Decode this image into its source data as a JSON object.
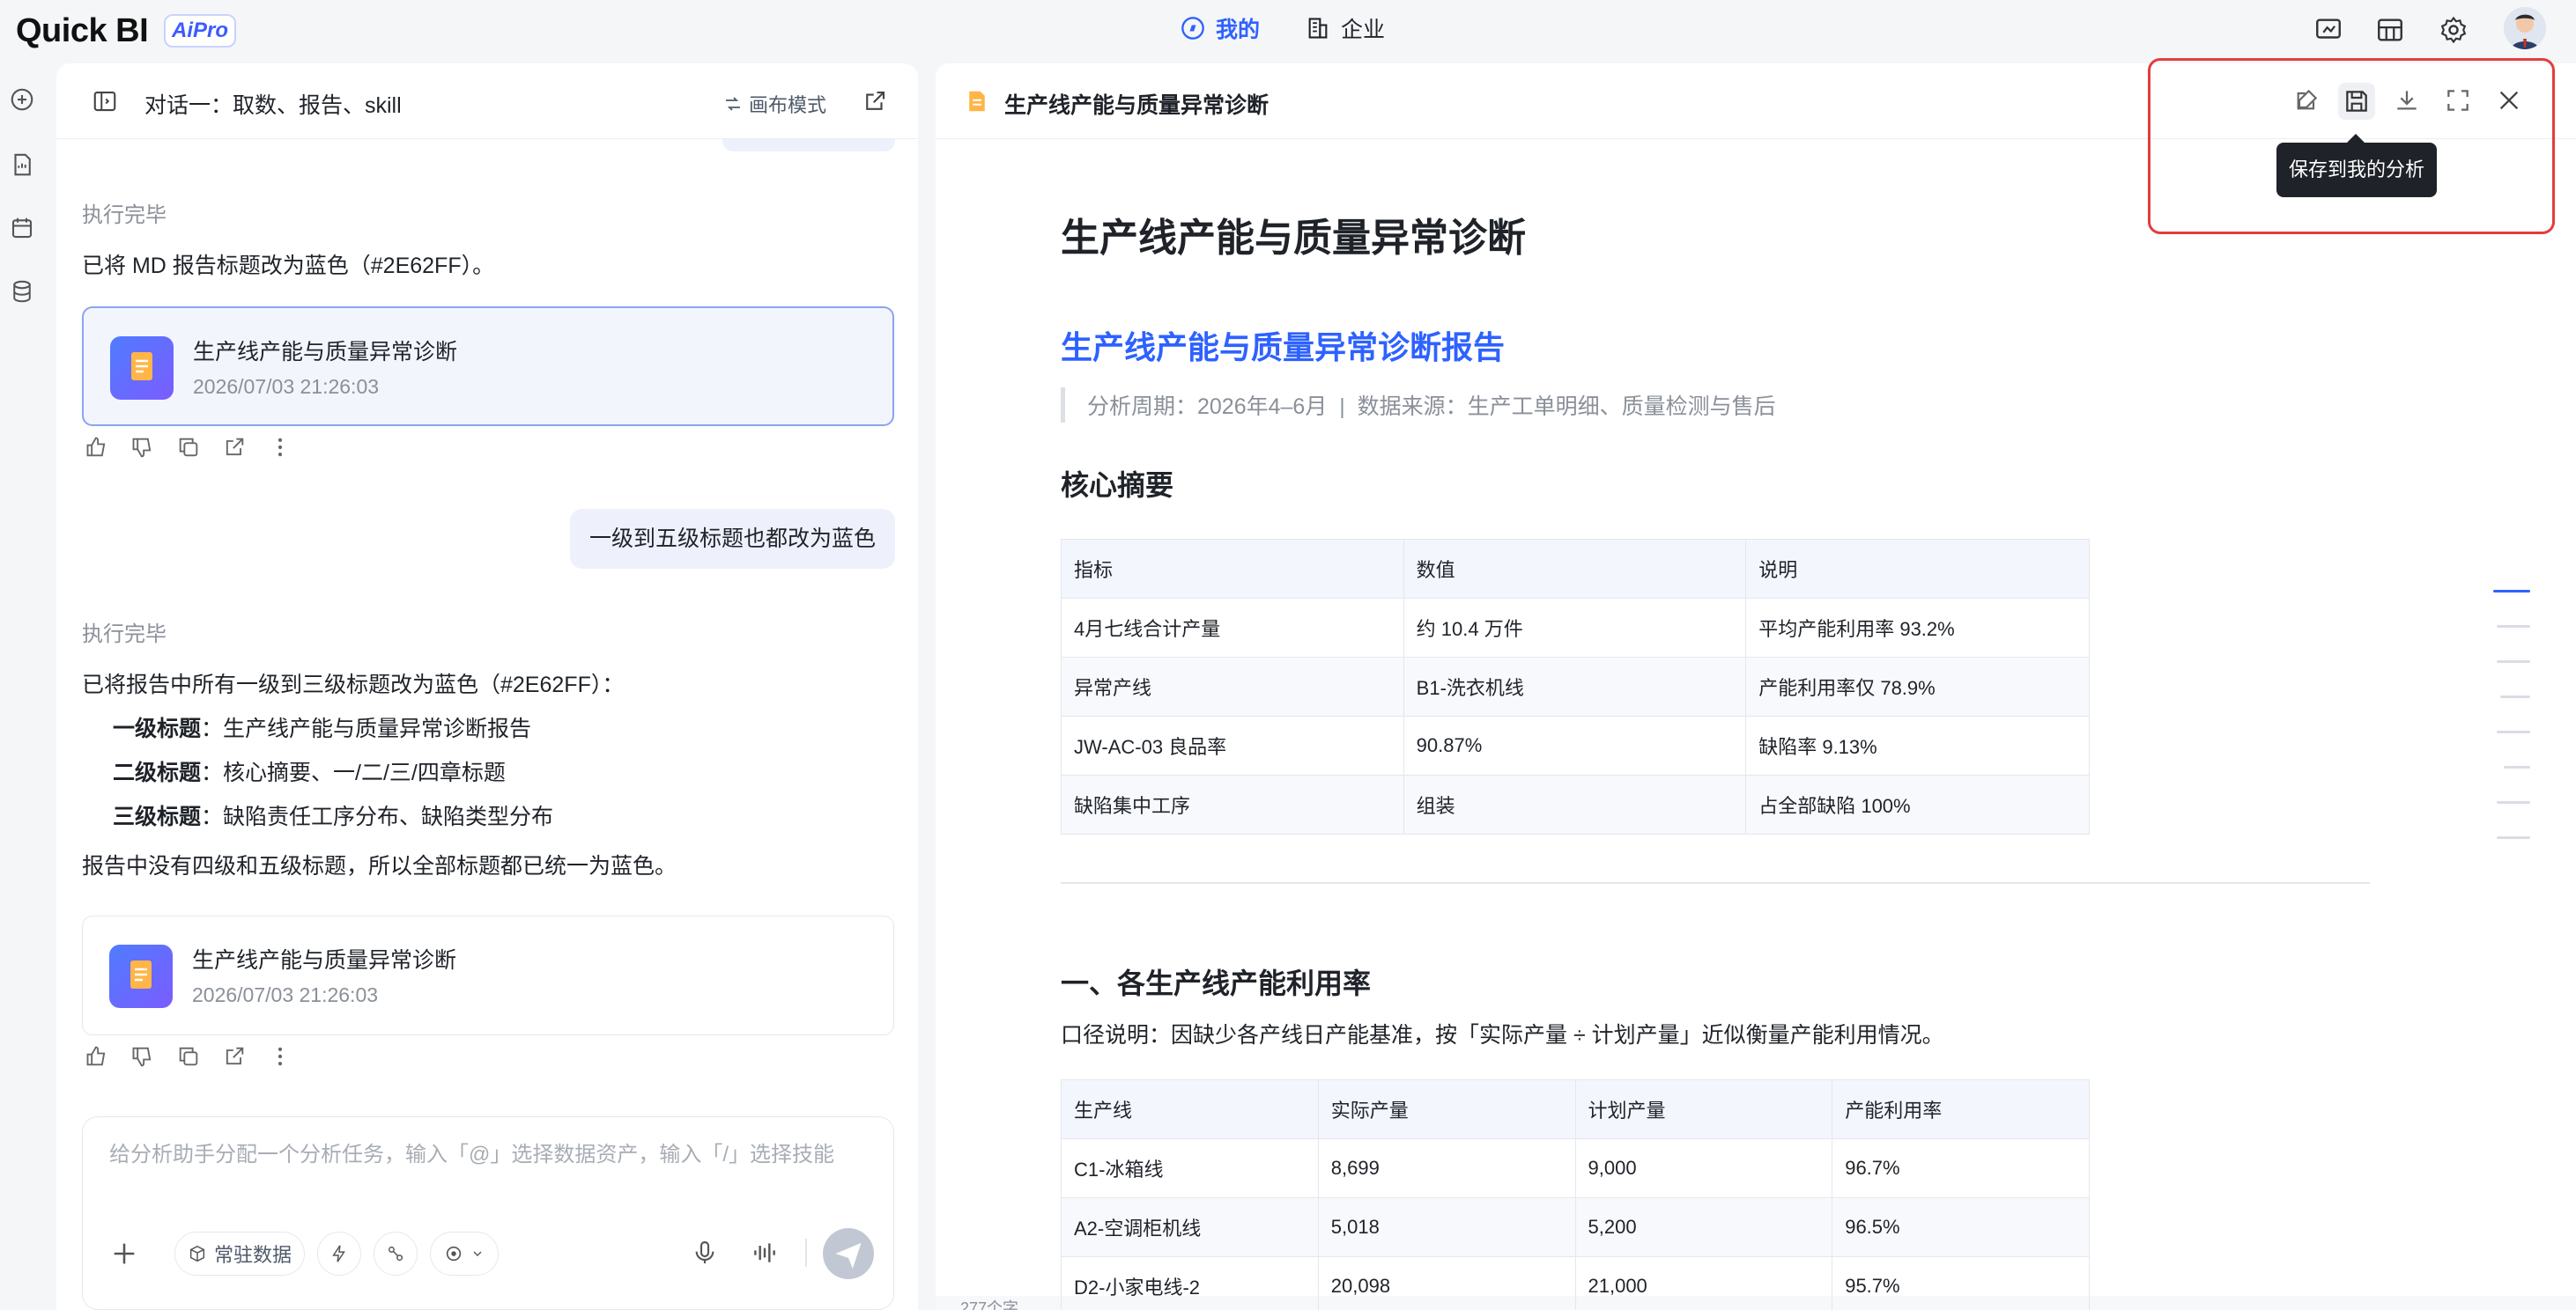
{
  "app": {
    "logo": "Quick BI",
    "badge": "AiPro"
  },
  "nav": {
    "mine": "我的",
    "enterprise": "企业"
  },
  "chat": {
    "title": "对话一：取数、报告、skill",
    "canvas_mode": "画布模式",
    "status1": "执行完毕",
    "msg1": "已将 MD 报告标题改为蓝色（#2E62FF）。",
    "card1": {
      "title": "生产线产能与质量异常诊断",
      "date": "2026/07/03 21:26:03"
    },
    "user_msg": "一级到五级标题也都改为蓝色",
    "status2": "执行完毕",
    "msg2": "已将报告中所有一级到三级标题改为蓝色（#2E62FF）：",
    "bullets": [
      {
        "label": "一级标题",
        "text": "：生产线产能与质量异常诊断报告"
      },
      {
        "label": "二级标题",
        "text": "：核心摘要、一/二/三/四章标题"
      },
      {
        "label": "三级标题",
        "text": "：缺陷责任工序分布、缺陷类型分布"
      }
    ],
    "msg3": "报告中没有四级和五级标题，所以全部标题都已统一为蓝色。",
    "card2": {
      "title": "生产线产能与质量异常诊断",
      "date": "2026/07/03 21:26:03"
    },
    "input_placeholder": "给分析助手分配一个分析任务，输入「@」选择数据资产，输入「/」选择技能",
    "chip_data": "常驻数据"
  },
  "report": {
    "tab_title": "生产线产能与质量异常诊断",
    "tooltip": "保存到我的分析",
    "h_doc": "生产线产能与质量异常诊断",
    "h_report": "生产线产能与质量异常诊断报告",
    "meta": "分析周期：2026年4–6月  |  数据来源：生产工单明细、质量检测与售后",
    "h_summary": "核心摘要",
    "summary_table": {
      "headers": [
        "指标",
        "数值",
        "说明"
      ],
      "rows": [
        [
          "4月七线合计产量",
          "约 10.4 万件",
          "平均产能利用率 93.2%"
        ],
        [
          "异常产线",
          "B1-洗衣机线",
          "产能利用率仅 78.9%"
        ],
        [
          "JW-AC-03 良品率",
          "90.87%",
          "缺陷率 9.13%"
        ],
        [
          "缺陷集中工序",
          "组装",
          "占全部缺陷 100%"
        ]
      ]
    },
    "h_section1": "一、各生产线产能利用率",
    "caliber": "口径说明：因缺少各产线日产能基准，按「实际产量 ÷ 计划产量」近似衡量产能利用情况。",
    "capacity_table": {
      "headers": [
        "生产线",
        "实际产量",
        "计划产量",
        "产能利用率"
      ],
      "rows": [
        [
          "C1-冰箱线",
          "8,699",
          "9,000",
          "96.7%"
        ],
        [
          "A2-空调柜机线",
          "5,018",
          "5,200",
          "96.5%"
        ],
        [
          "D2-小家电线-2",
          "20,098",
          "21,000",
          "95.7%"
        ]
      ]
    },
    "footer_count": "277个字"
  },
  "colors": {
    "accent": "#2E62FF",
    "highlight_box": "#E43C3C"
  }
}
